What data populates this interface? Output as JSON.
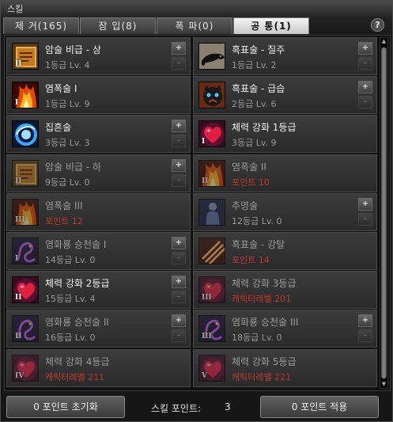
{
  "window": {
    "title": "스킬"
  },
  "tabs": [
    {
      "label": "제 거(165)",
      "active": false
    },
    {
      "label": "잠 입(8)",
      "active": false
    },
    {
      "label": "폭 파(0)",
      "active": false
    },
    {
      "label": "공 통(1)",
      "active": true
    }
  ],
  "help_label": "?",
  "skills": [
    {
      "name": "암술 비급 - 상",
      "info": "1등급 Lv. 4",
      "icon": "scroll-icon",
      "rank": "II",
      "plus": true,
      "minus": true,
      "dim": false,
      "info_color": "gray"
    },
    {
      "name": "흑표술 - 질주",
      "info": "1등급 Lv. 2",
      "icon": "panther-run-icon",
      "rank": "",
      "plus": true,
      "minus": true,
      "dim": false,
      "info_color": "gray"
    },
    {
      "name": "염폭술 I",
      "info": "1등급 Lv. 9",
      "icon": "fire-icon",
      "rank": "I",
      "plus": false,
      "minus": false,
      "dim": false,
      "info_color": "gray"
    },
    {
      "name": "흑표술 - 급습",
      "info": "2등급 Lv. 6",
      "icon": "panther-face-icon",
      "rank": "",
      "plus": true,
      "minus": true,
      "dim": false,
      "info_color": "gray"
    },
    {
      "name": "집혼술",
      "info": "3등급 Lv. 3",
      "icon": "spirit-swirl-icon",
      "rank": "",
      "plus": true,
      "minus": true,
      "dim": false,
      "info_color": "gray"
    },
    {
      "name": "체력 강화 1등급",
      "info": "3등급 Lv. 9",
      "icon": "heart-icon",
      "rank": "I",
      "plus": false,
      "minus": false,
      "dim": false,
      "info_color": "gray"
    },
    {
      "name": "암술 비급 - 하",
      "info": "9등급 Lv. 0",
      "icon": "scroll-icon",
      "rank": "II",
      "plus": true,
      "minus": true,
      "dim": true,
      "info_color": "gray"
    },
    {
      "name": "염폭술 II",
      "info": "포인트 10",
      "icon": "fire-icon",
      "rank": "II",
      "plus": false,
      "minus": false,
      "dim": true,
      "info_color": "red"
    },
    {
      "name": "염폭술 III",
      "info": "포인트 12",
      "icon": "fire-icon",
      "rank": "III",
      "plus": false,
      "minus": false,
      "dim": true,
      "info_color": "red"
    },
    {
      "name": "추영술",
      "info": "12등급 Lv. 0",
      "icon": "shadow-figure-icon",
      "rank": "",
      "plus": true,
      "minus": true,
      "dim": true,
      "info_color": "gray"
    },
    {
      "name": "염화룡 승천술 I",
      "info": "14등급 Lv. 0",
      "icon": "dragon-icon",
      "rank": "I",
      "plus": true,
      "minus": true,
      "dim": true,
      "info_color": "gray"
    },
    {
      "name": "흑표술 - 강탈",
      "info": "포인트 14",
      "icon": "claw-icon",
      "rank": "",
      "plus": false,
      "minus": false,
      "dim": true,
      "info_color": "red"
    },
    {
      "name": "체력 강화 2등급",
      "info": "15등급 Lv. 4",
      "icon": "heart-icon",
      "rank": "II",
      "plus": true,
      "minus": true,
      "dim": false,
      "info_color": "gray"
    },
    {
      "name": "체력 강화 3등급",
      "info": "캐릭터레벨 201",
      "icon": "heart-icon",
      "rank": "III",
      "plus": false,
      "minus": false,
      "dim": true,
      "info_color": "red"
    },
    {
      "name": "염화룡 승천술 II",
      "info": "16등급 Lv. 0",
      "icon": "dragon-icon",
      "rank": "II",
      "plus": true,
      "minus": true,
      "dim": true,
      "info_color": "gray"
    },
    {
      "name": "염화룡 승천술 III",
      "info": "18등급 Lv. 0",
      "icon": "dragon-icon",
      "rank": "III",
      "plus": true,
      "minus": true,
      "dim": true,
      "info_color": "gray"
    },
    {
      "name": "체력 강화 4등급",
      "info": "캐릭터레벨 211",
      "icon": "heart-icon",
      "rank": "IV",
      "plus": false,
      "minus": false,
      "dim": true,
      "info_color": "red"
    },
    {
      "name": "체력 강화 5등급",
      "info": "캐릭터레벨 221",
      "icon": "heart-icon",
      "rank": "V",
      "plus": false,
      "minus": false,
      "dim": true,
      "info_color": "red"
    }
  ],
  "bottom": {
    "reset_label": "0 포인트 초기화",
    "points_label": "스킬 포인트:",
    "points_value": "3",
    "apply_label": "0 포인트 적용"
  },
  "colors": {
    "accent_red": "#c0392b",
    "active_tab": "#e0e0e0"
  }
}
